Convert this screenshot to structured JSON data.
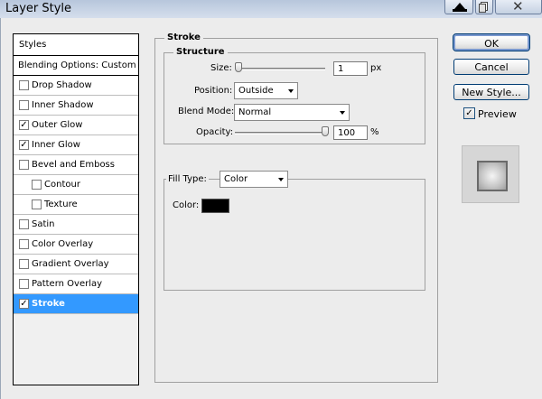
{
  "window": {
    "title": "Layer Style"
  },
  "styles_panel": {
    "header": "Styles",
    "blending_options": "Blending Options: Custom",
    "items": [
      {
        "label": "Drop Shadow",
        "checked": false,
        "indent": false,
        "selected": false
      },
      {
        "label": "Inner Shadow",
        "checked": false,
        "indent": false,
        "selected": false
      },
      {
        "label": "Outer Glow",
        "checked": true,
        "indent": false,
        "selected": false
      },
      {
        "label": "Inner Glow",
        "checked": true,
        "indent": false,
        "selected": false
      },
      {
        "label": "Bevel and Emboss",
        "checked": false,
        "indent": false,
        "selected": false
      },
      {
        "label": "Contour",
        "checked": false,
        "indent": true,
        "selected": false
      },
      {
        "label": "Texture",
        "checked": false,
        "indent": true,
        "selected": false
      },
      {
        "label": "Satin",
        "checked": false,
        "indent": false,
        "selected": false
      },
      {
        "label": "Color Overlay",
        "checked": false,
        "indent": false,
        "selected": false
      },
      {
        "label": "Gradient Overlay",
        "checked": false,
        "indent": false,
        "selected": false
      },
      {
        "label": "Pattern Overlay",
        "checked": false,
        "indent": false,
        "selected": false
      },
      {
        "label": "Stroke",
        "checked": true,
        "indent": false,
        "selected": true
      }
    ]
  },
  "stroke": {
    "title": "Stroke",
    "structure": {
      "title": "Structure",
      "size_label": "Size:",
      "size_value": "1",
      "size_unit": "px",
      "size_level": 0.0,
      "position_label": "Position:",
      "position_value": "Outside",
      "blend_mode_label": "Blend Mode:",
      "blend_mode_value": "Normal",
      "opacity_label": "Opacity:",
      "opacity_value": "100",
      "opacity_unit": "%",
      "opacity_level": 1.0
    },
    "fill": {
      "fill_type_label": "Fill Type:",
      "fill_type_value": "Color",
      "color_label": "Color:",
      "color": "#000000"
    }
  },
  "buttons": {
    "ok": "OK",
    "cancel": "Cancel",
    "new_style": "New Style...",
    "preview_label": "Preview",
    "preview_checked": true
  },
  "colors": {
    "selection": "#3399ff",
    "dialog_bg": "#ececec"
  }
}
